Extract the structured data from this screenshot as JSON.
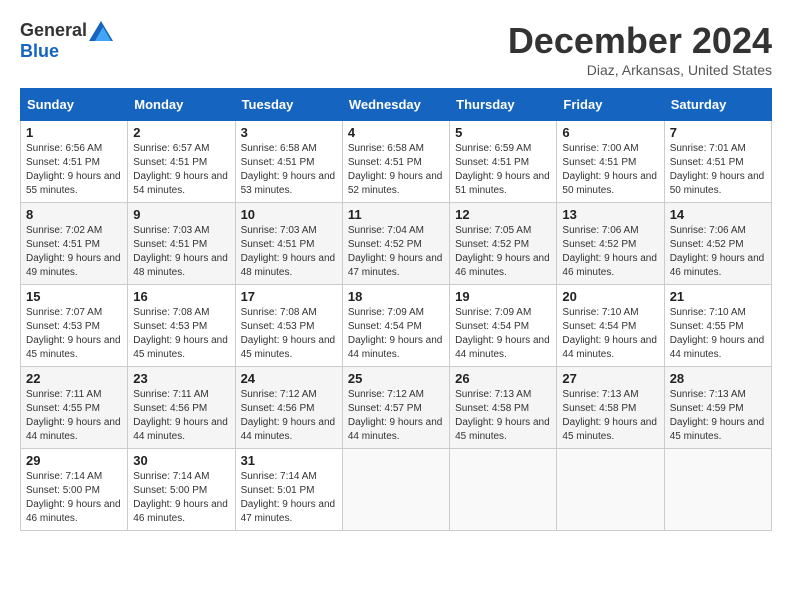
{
  "header": {
    "logo_general": "General",
    "logo_blue": "Blue",
    "month_title": "December 2024",
    "location": "Diaz, Arkansas, United States"
  },
  "weekdays": [
    "Sunday",
    "Monday",
    "Tuesday",
    "Wednesday",
    "Thursday",
    "Friday",
    "Saturday"
  ],
  "weeks": [
    [
      {
        "day": "1",
        "sunrise": "6:56 AM",
        "sunset": "4:51 PM",
        "daylight": "9 hours and 55 minutes."
      },
      {
        "day": "2",
        "sunrise": "6:57 AM",
        "sunset": "4:51 PM",
        "daylight": "9 hours and 54 minutes."
      },
      {
        "day": "3",
        "sunrise": "6:58 AM",
        "sunset": "4:51 PM",
        "daylight": "9 hours and 53 minutes."
      },
      {
        "day": "4",
        "sunrise": "6:58 AM",
        "sunset": "4:51 PM",
        "daylight": "9 hours and 52 minutes."
      },
      {
        "day": "5",
        "sunrise": "6:59 AM",
        "sunset": "4:51 PM",
        "daylight": "9 hours and 51 minutes."
      },
      {
        "day": "6",
        "sunrise": "7:00 AM",
        "sunset": "4:51 PM",
        "daylight": "9 hours and 50 minutes."
      },
      {
        "day": "7",
        "sunrise": "7:01 AM",
        "sunset": "4:51 PM",
        "daylight": "9 hours and 50 minutes."
      }
    ],
    [
      {
        "day": "8",
        "sunrise": "7:02 AM",
        "sunset": "4:51 PM",
        "daylight": "9 hours and 49 minutes."
      },
      {
        "day": "9",
        "sunrise": "7:03 AM",
        "sunset": "4:51 PM",
        "daylight": "9 hours and 48 minutes."
      },
      {
        "day": "10",
        "sunrise": "7:03 AM",
        "sunset": "4:51 PM",
        "daylight": "9 hours and 48 minutes."
      },
      {
        "day": "11",
        "sunrise": "7:04 AM",
        "sunset": "4:52 PM",
        "daylight": "9 hours and 47 minutes."
      },
      {
        "day": "12",
        "sunrise": "7:05 AM",
        "sunset": "4:52 PM",
        "daylight": "9 hours and 46 minutes."
      },
      {
        "day": "13",
        "sunrise": "7:06 AM",
        "sunset": "4:52 PM",
        "daylight": "9 hours and 46 minutes."
      },
      {
        "day": "14",
        "sunrise": "7:06 AM",
        "sunset": "4:52 PM",
        "daylight": "9 hours and 46 minutes."
      }
    ],
    [
      {
        "day": "15",
        "sunrise": "7:07 AM",
        "sunset": "4:53 PM",
        "daylight": "9 hours and 45 minutes."
      },
      {
        "day": "16",
        "sunrise": "7:08 AM",
        "sunset": "4:53 PM",
        "daylight": "9 hours and 45 minutes."
      },
      {
        "day": "17",
        "sunrise": "7:08 AM",
        "sunset": "4:53 PM",
        "daylight": "9 hours and 45 minutes."
      },
      {
        "day": "18",
        "sunrise": "7:09 AM",
        "sunset": "4:54 PM",
        "daylight": "9 hours and 44 minutes."
      },
      {
        "day": "19",
        "sunrise": "7:09 AM",
        "sunset": "4:54 PM",
        "daylight": "9 hours and 44 minutes."
      },
      {
        "day": "20",
        "sunrise": "7:10 AM",
        "sunset": "4:54 PM",
        "daylight": "9 hours and 44 minutes."
      },
      {
        "day": "21",
        "sunrise": "7:10 AM",
        "sunset": "4:55 PM",
        "daylight": "9 hours and 44 minutes."
      }
    ],
    [
      {
        "day": "22",
        "sunrise": "7:11 AM",
        "sunset": "4:55 PM",
        "daylight": "9 hours and 44 minutes."
      },
      {
        "day": "23",
        "sunrise": "7:11 AM",
        "sunset": "4:56 PM",
        "daylight": "9 hours and 44 minutes."
      },
      {
        "day": "24",
        "sunrise": "7:12 AM",
        "sunset": "4:56 PM",
        "daylight": "9 hours and 44 minutes."
      },
      {
        "day": "25",
        "sunrise": "7:12 AM",
        "sunset": "4:57 PM",
        "daylight": "9 hours and 44 minutes."
      },
      {
        "day": "26",
        "sunrise": "7:13 AM",
        "sunset": "4:58 PM",
        "daylight": "9 hours and 45 minutes."
      },
      {
        "day": "27",
        "sunrise": "7:13 AM",
        "sunset": "4:58 PM",
        "daylight": "9 hours and 45 minutes."
      },
      {
        "day": "28",
        "sunrise": "7:13 AM",
        "sunset": "4:59 PM",
        "daylight": "9 hours and 45 minutes."
      }
    ],
    [
      {
        "day": "29",
        "sunrise": "7:14 AM",
        "sunset": "5:00 PM",
        "daylight": "9 hours and 46 minutes."
      },
      {
        "day": "30",
        "sunrise": "7:14 AM",
        "sunset": "5:00 PM",
        "daylight": "9 hours and 46 minutes."
      },
      {
        "day": "31",
        "sunrise": "7:14 AM",
        "sunset": "5:01 PM",
        "daylight": "9 hours and 47 minutes."
      },
      null,
      null,
      null,
      null
    ]
  ],
  "labels": {
    "sunrise_prefix": "Sunrise: ",
    "sunset_prefix": "Sunset: ",
    "daylight_prefix": "Daylight: "
  }
}
